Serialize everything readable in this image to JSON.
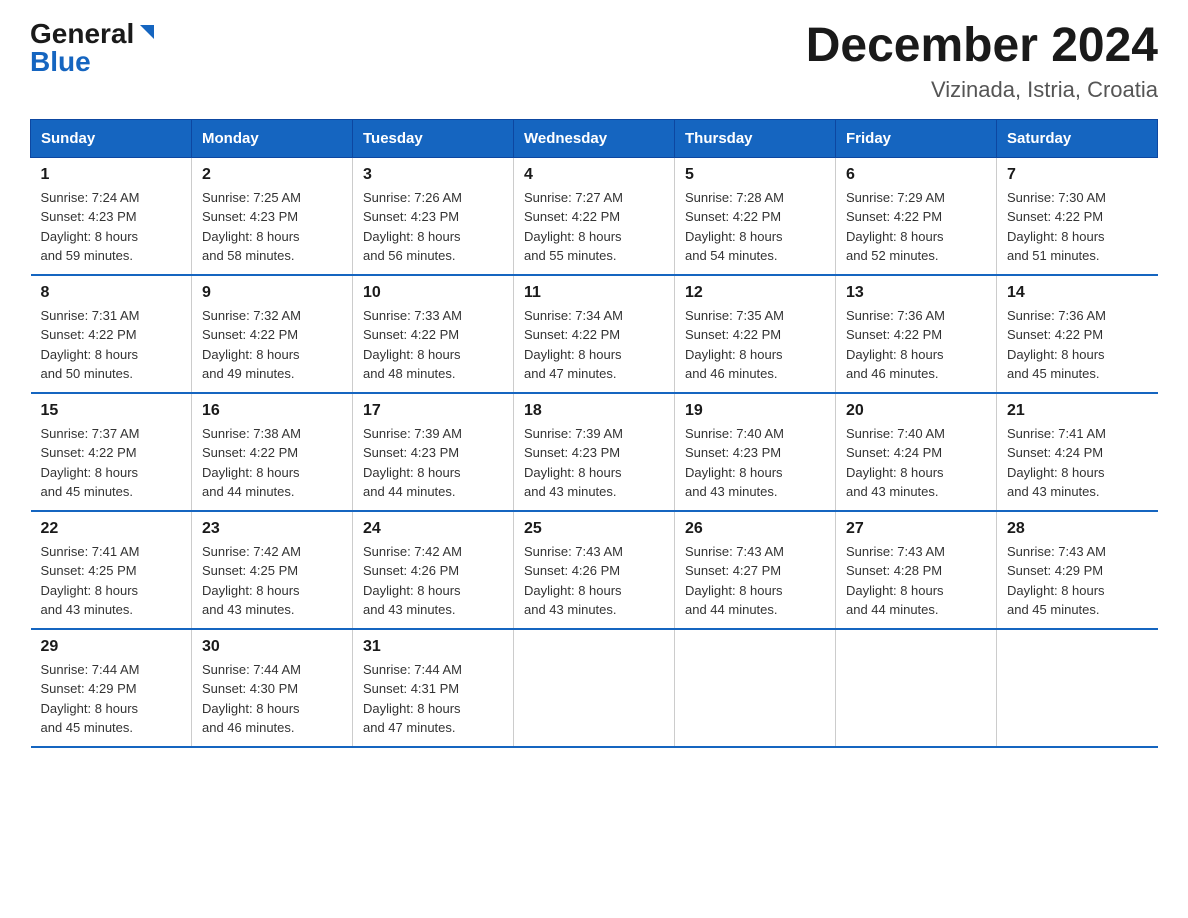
{
  "header": {
    "logo_general": "General",
    "logo_blue": "Blue",
    "main_title": "December 2024",
    "subtitle": "Vizinada, Istria, Croatia"
  },
  "days_of_week": [
    "Sunday",
    "Monday",
    "Tuesday",
    "Wednesday",
    "Thursday",
    "Friday",
    "Saturday"
  ],
  "weeks": [
    [
      {
        "day": "1",
        "sunrise": "7:24 AM",
        "sunset": "4:23 PM",
        "daylight": "8 hours and 59 minutes."
      },
      {
        "day": "2",
        "sunrise": "7:25 AM",
        "sunset": "4:23 PM",
        "daylight": "8 hours and 58 minutes."
      },
      {
        "day": "3",
        "sunrise": "7:26 AM",
        "sunset": "4:23 PM",
        "daylight": "8 hours and 56 minutes."
      },
      {
        "day": "4",
        "sunrise": "7:27 AM",
        "sunset": "4:22 PM",
        "daylight": "8 hours and 55 minutes."
      },
      {
        "day": "5",
        "sunrise": "7:28 AM",
        "sunset": "4:22 PM",
        "daylight": "8 hours and 54 minutes."
      },
      {
        "day": "6",
        "sunrise": "7:29 AM",
        "sunset": "4:22 PM",
        "daylight": "8 hours and 52 minutes."
      },
      {
        "day": "7",
        "sunrise": "7:30 AM",
        "sunset": "4:22 PM",
        "daylight": "8 hours and 51 minutes."
      }
    ],
    [
      {
        "day": "8",
        "sunrise": "7:31 AM",
        "sunset": "4:22 PM",
        "daylight": "8 hours and 50 minutes."
      },
      {
        "day": "9",
        "sunrise": "7:32 AM",
        "sunset": "4:22 PM",
        "daylight": "8 hours and 49 minutes."
      },
      {
        "day": "10",
        "sunrise": "7:33 AM",
        "sunset": "4:22 PM",
        "daylight": "8 hours and 48 minutes."
      },
      {
        "day": "11",
        "sunrise": "7:34 AM",
        "sunset": "4:22 PM",
        "daylight": "8 hours and 47 minutes."
      },
      {
        "day": "12",
        "sunrise": "7:35 AM",
        "sunset": "4:22 PM",
        "daylight": "8 hours and 46 minutes."
      },
      {
        "day": "13",
        "sunrise": "7:36 AM",
        "sunset": "4:22 PM",
        "daylight": "8 hours and 46 minutes."
      },
      {
        "day": "14",
        "sunrise": "7:36 AM",
        "sunset": "4:22 PM",
        "daylight": "8 hours and 45 minutes."
      }
    ],
    [
      {
        "day": "15",
        "sunrise": "7:37 AM",
        "sunset": "4:22 PM",
        "daylight": "8 hours and 45 minutes."
      },
      {
        "day": "16",
        "sunrise": "7:38 AM",
        "sunset": "4:22 PM",
        "daylight": "8 hours and 44 minutes."
      },
      {
        "day": "17",
        "sunrise": "7:39 AM",
        "sunset": "4:23 PM",
        "daylight": "8 hours and 44 minutes."
      },
      {
        "day": "18",
        "sunrise": "7:39 AM",
        "sunset": "4:23 PM",
        "daylight": "8 hours and 43 minutes."
      },
      {
        "day": "19",
        "sunrise": "7:40 AM",
        "sunset": "4:23 PM",
        "daylight": "8 hours and 43 minutes."
      },
      {
        "day": "20",
        "sunrise": "7:40 AM",
        "sunset": "4:24 PM",
        "daylight": "8 hours and 43 minutes."
      },
      {
        "day": "21",
        "sunrise": "7:41 AM",
        "sunset": "4:24 PM",
        "daylight": "8 hours and 43 minutes."
      }
    ],
    [
      {
        "day": "22",
        "sunrise": "7:41 AM",
        "sunset": "4:25 PM",
        "daylight": "8 hours and 43 minutes."
      },
      {
        "day": "23",
        "sunrise": "7:42 AM",
        "sunset": "4:25 PM",
        "daylight": "8 hours and 43 minutes."
      },
      {
        "day": "24",
        "sunrise": "7:42 AM",
        "sunset": "4:26 PM",
        "daylight": "8 hours and 43 minutes."
      },
      {
        "day": "25",
        "sunrise": "7:43 AM",
        "sunset": "4:26 PM",
        "daylight": "8 hours and 43 minutes."
      },
      {
        "day": "26",
        "sunrise": "7:43 AM",
        "sunset": "4:27 PM",
        "daylight": "8 hours and 44 minutes."
      },
      {
        "day": "27",
        "sunrise": "7:43 AM",
        "sunset": "4:28 PM",
        "daylight": "8 hours and 44 minutes."
      },
      {
        "day": "28",
        "sunrise": "7:43 AM",
        "sunset": "4:29 PM",
        "daylight": "8 hours and 45 minutes."
      }
    ],
    [
      {
        "day": "29",
        "sunrise": "7:44 AM",
        "sunset": "4:29 PM",
        "daylight": "8 hours and 45 minutes."
      },
      {
        "day": "30",
        "sunrise": "7:44 AM",
        "sunset": "4:30 PM",
        "daylight": "8 hours and 46 minutes."
      },
      {
        "day": "31",
        "sunrise": "7:44 AM",
        "sunset": "4:31 PM",
        "daylight": "8 hours and 47 minutes."
      },
      null,
      null,
      null,
      null
    ]
  ],
  "labels": {
    "sunrise": "Sunrise:",
    "sunset": "Sunset:",
    "daylight": "Daylight:"
  },
  "colors": {
    "header_bg": "#1565c0",
    "border": "#1565c0",
    "logo_blue": "#1565c0"
  }
}
